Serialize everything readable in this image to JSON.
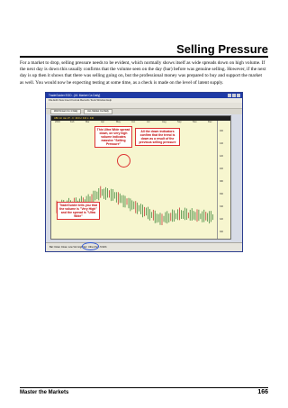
{
  "header": {
    "title": "Selling Pressure"
  },
  "body": {
    "p1": "For a market to drop, selling pressure needs to be evident, which normally shows itself as wide spreads down on high volume. If the next day is down this usually confirms that the volume seen on the day (bar) before was genuine selling. However, if the next day is up then it shows that there was selling going on, but the professional money was prepared to buy and support the market as well. You would now be expecting testing at some time, as a check is made on the level of latent supply."
  },
  "screenshot": {
    "window_title": "TradeGuider EOD - [#1 Market Ca Daily]",
    "menu": "File  Edit  View  Insert  Format  Records  Tools  Window  Help",
    "tabs": [
      "Well Known Co 1 Daily",
      "ALL Market Ca Daily"
    ],
    "chart_header": "ABC  Hi: Jan-07 - C: 443  H: 444  L: 440",
    "months": [
      "2004",
      "Feb",
      "Mar",
      "Apr",
      "May",
      "Jun",
      "Jul",
      "Aug",
      "Sep",
      "Nov",
      "Dec"
    ],
    "price_ticks": [
      "460",
      "440",
      "420",
      "400",
      "380",
      "360",
      "340",
      "320",
      "300"
    ],
    "callouts": {
      "top_left": "This Ultra Wide spread down, on very high volume indicates massive \"Selling Pressure\"",
      "top_right": "All the down indicators confirm that the trend is down as a result of the previous selling pressure",
      "bottom_left": "TradeGuider tells you that the volume is \"Very High\" and the spread is \"Ultra Wide\""
    },
    "status_bar": "Bar: Down    Close: Low    Vol: High    Spr: Ultra    Chg: -5.91%"
  },
  "footer": {
    "left": "Master the Markets",
    "page": "166"
  }
}
